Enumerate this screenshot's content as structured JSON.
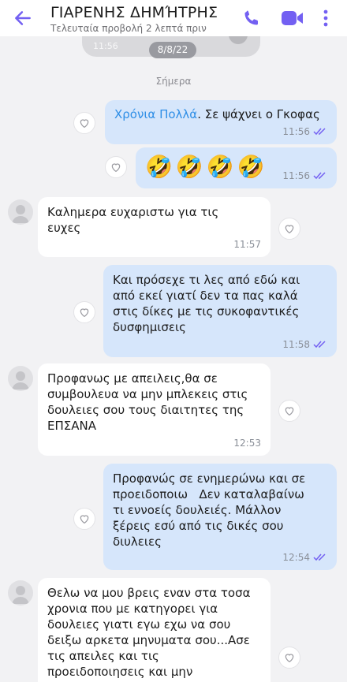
{
  "header": {
    "contact_name": "ΓΙΑΡΕΝΗΣ ΔΗΜΉΤΡΗΣ",
    "last_seen": "Τελευταία προβολή 2 λεπτά πριν",
    "icons": [
      "back-arrow-icon",
      "phone-icon",
      "video-icon",
      "more-icon"
    ],
    "accent_color": "#7360f2"
  },
  "history": {
    "peek_time": "11:56",
    "date_pill": "8/8/22"
  },
  "day_separator": "Σήμερα",
  "messages": [
    {
      "direction": "out",
      "text_link": "Χρόνια Πολλά",
      "text_rest": ". Σε ψάχνει ο Γκοφας",
      "time": "11:56"
    },
    {
      "direction": "out",
      "emoji": "🤣🤣🤣🤣",
      "time": "11:56"
    },
    {
      "direction": "in",
      "text": "Καλημερα ευχαριστω για τις\nευχες",
      "time": "11:57"
    },
    {
      "direction": "out",
      "text": "Και πρόσεχε τι λες από εδώ και\nαπό εκεί γιατί δεν τα πας καλά\nστις δίκες με τις συκοφαντικές\nδυσφημισεις",
      "time": "11:58"
    },
    {
      "direction": "in",
      "text": "Προφανως με απειλεις,θα σε\nσυμβουλευα να μην μπλεκεις στις\nδουλειες σου τους διαιτητες της\nΕΠΣΑΝΑ",
      "time": "12:53"
    },
    {
      "direction": "out",
      "text": "Προφανώς σε ενημερώνω και σε\nπροειδοποιω   Δεν καταλαβαίνω\nτι εννοείς δουλειές. Μάλλον\nξέρεις εσύ από τις δικές σου\nδιυλειες",
      "time": "12:54"
    },
    {
      "direction": "in",
      "text": "Θελω να μου βρεις εναν στα τοσα\nχρονια που με κατηγορει για\nδουλειες γιατι εγω εχω να σου\nδειξω αρκετα μηνυματα σου...Ασε\nτις απειλες και τις\nπροειδοποιησεις και μην",
      "time": ""
    }
  ]
}
